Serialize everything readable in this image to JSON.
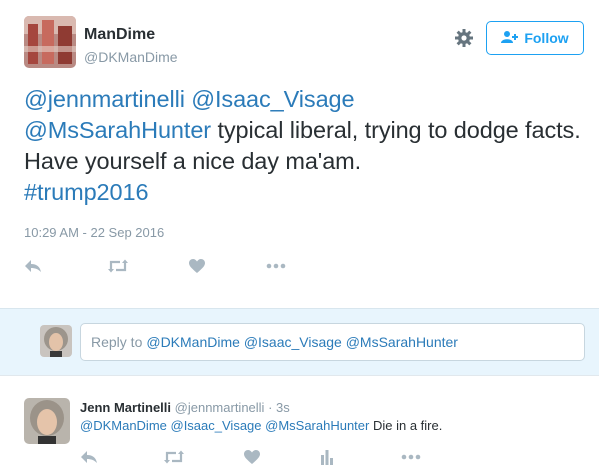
{
  "tweet": {
    "author_name": "ManDime",
    "author_handle": "@DKManDime",
    "follow_label": "Follow",
    "text_mentions": [
      "@jennmartinelli",
      "@Isaac_Visage",
      "@MsSarahHunter"
    ],
    "text_body": "typical liberal, trying to dodge facts. Have yourself a nice day ma'am.",
    "hashtag": "#trump2016",
    "timestamp": "10:29 AM - 22 Sep 2016",
    "actions": [
      "reply-icon",
      "retweet-icon",
      "like-icon",
      "more-icon"
    ]
  },
  "reply_box": {
    "prefix": "Reply to",
    "mentions": "@DKManDime @Isaac_Visage @MsSarahHunter"
  },
  "reply_tweet": {
    "author_name": "Jenn Martinelli",
    "author_handle": "@jennmartinelli",
    "separator": "·",
    "time": "3s",
    "mentions": "@DKManDime @Isaac_Visage @MsSarahHunter",
    "body": "Die in a fire.",
    "actions": [
      "reply-icon",
      "retweet-icon",
      "like-icon",
      "analytics-icon",
      "more-icon"
    ]
  },
  "colors": {
    "link": "#2b7bb9",
    "follow_blue": "#1da1f2",
    "muted": "#8899a6",
    "reply_bg": "#e8f5fd"
  }
}
